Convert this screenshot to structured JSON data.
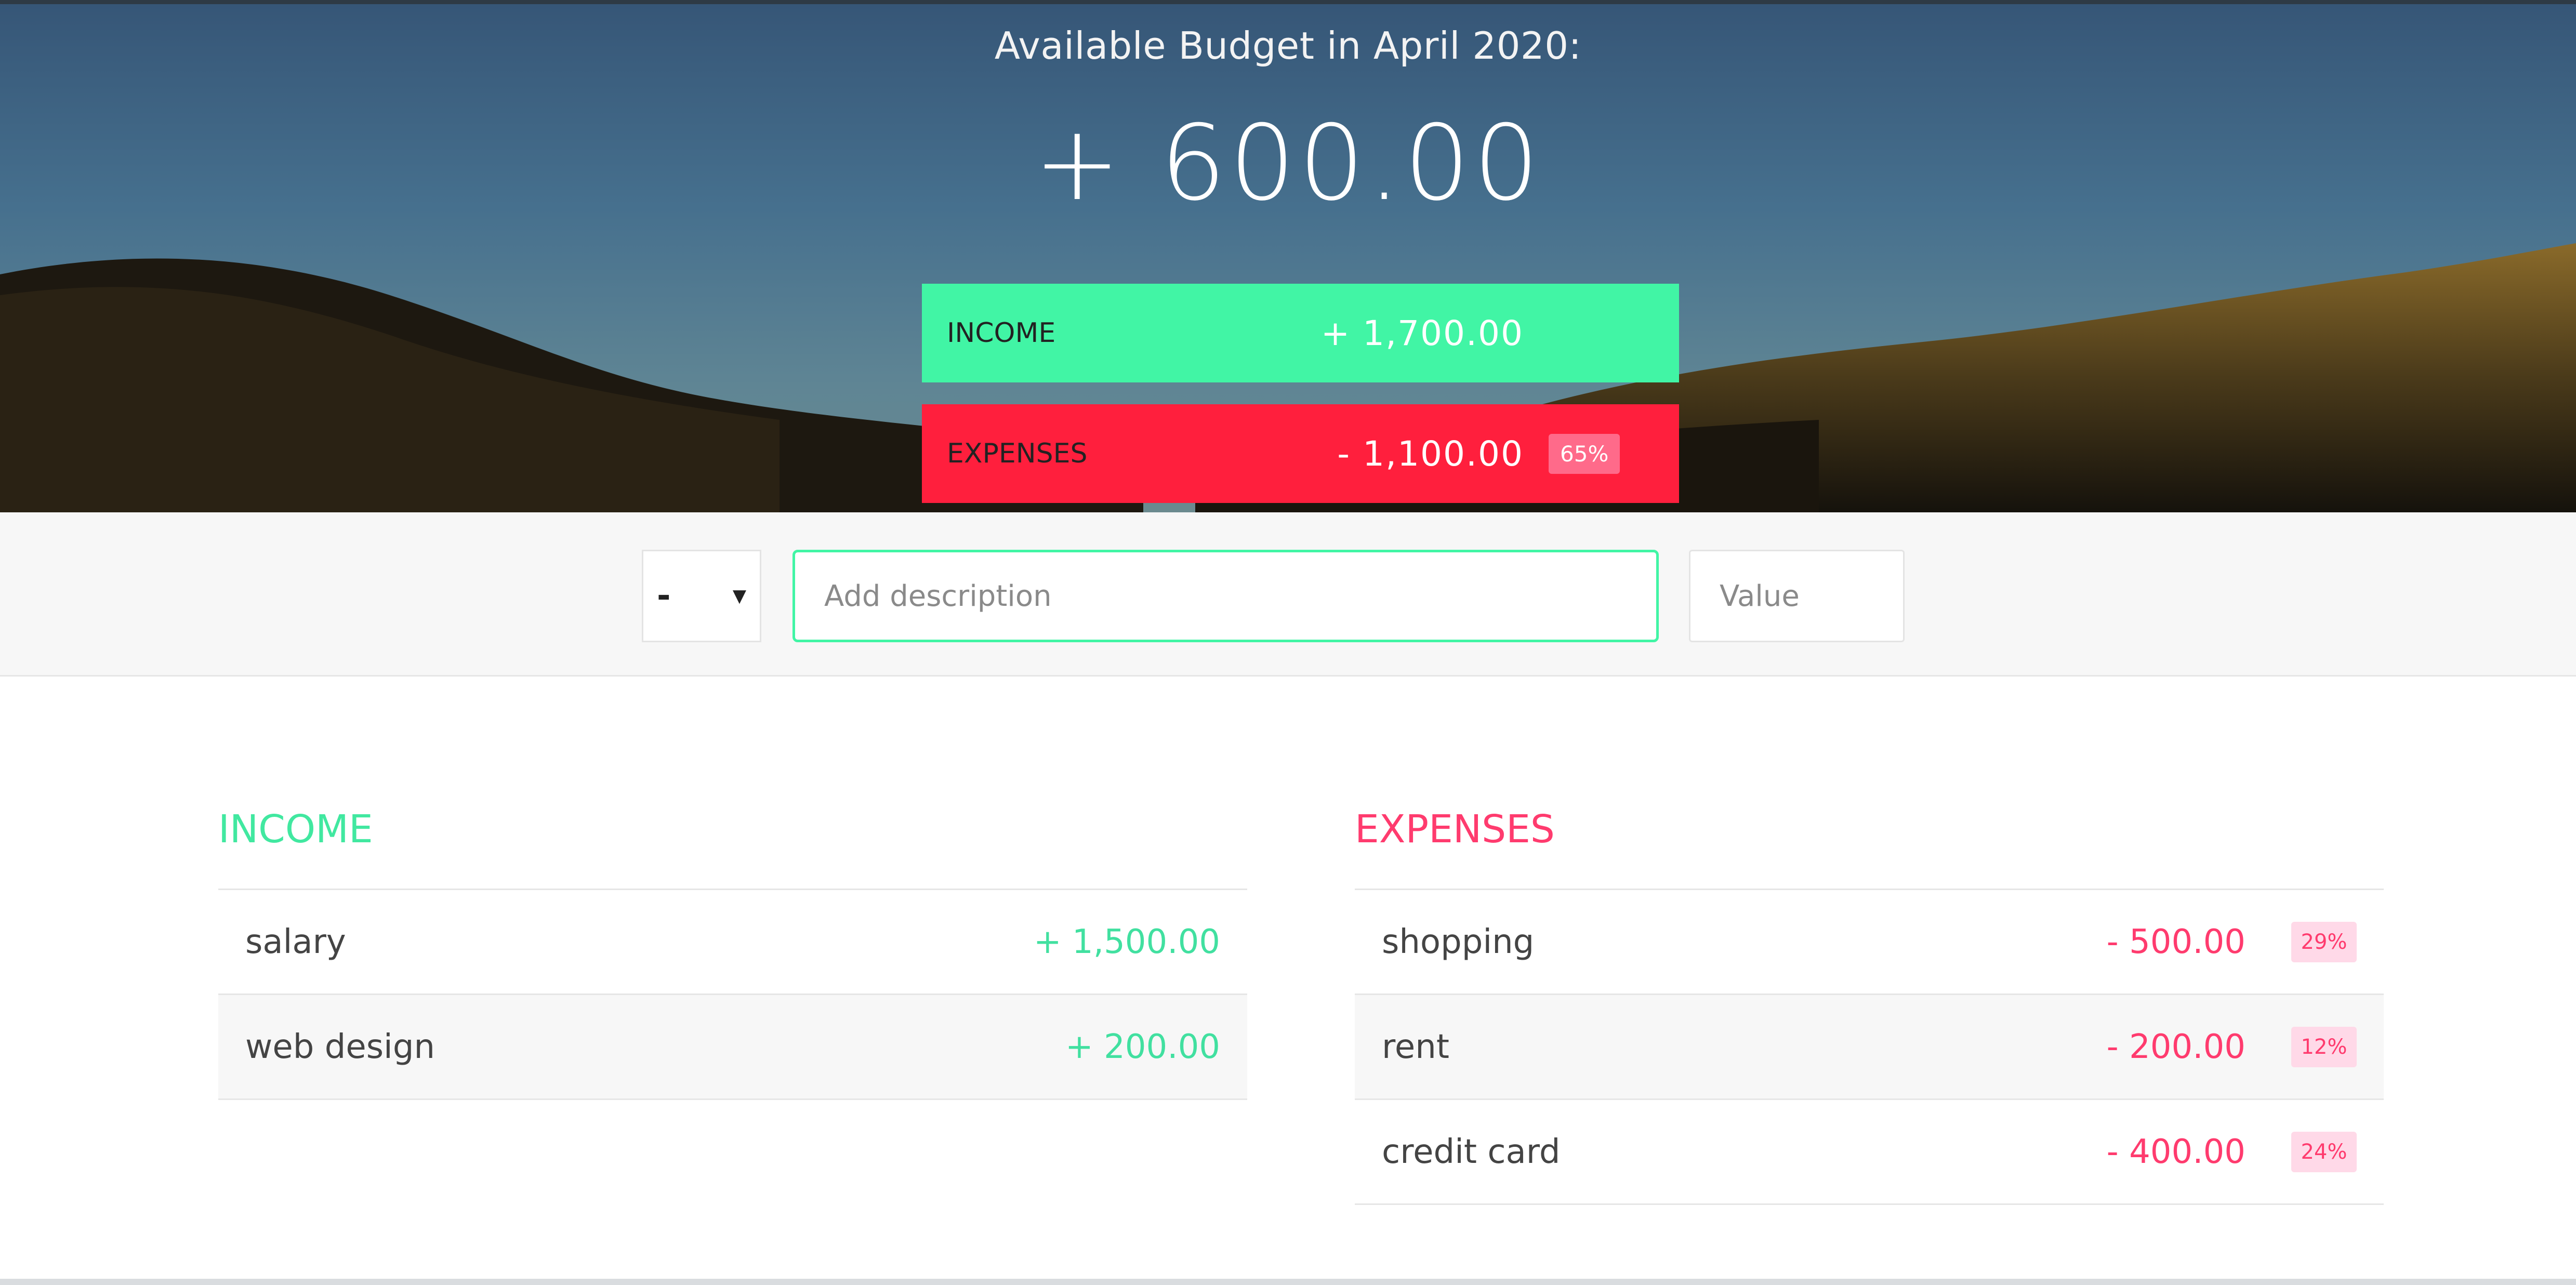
{
  "header": {
    "title": "Available Budget in April 2020:",
    "budget": "+ 600.00",
    "income": {
      "label": "INCOME",
      "value": "+ 1,700.00"
    },
    "expenses": {
      "label": "EXPENSES",
      "value": "- 1,100.00",
      "percentage": "65%"
    }
  },
  "add_bar": {
    "type_select": {
      "selected": "-",
      "options": [
        "+",
        "-"
      ]
    },
    "description_placeholder": "Add description",
    "value_placeholder": "Value"
  },
  "income_list": {
    "title": "INCOME",
    "items": [
      {
        "description": "salary",
        "value": "+ 1,500.00"
      },
      {
        "description": "web design",
        "value": "+ 200.00"
      }
    ]
  },
  "expense_list": {
    "title": "EXPENSES",
    "items": [
      {
        "description": "shopping",
        "value": "- 500.00",
        "percentage": "29%"
      },
      {
        "description": "rent",
        "value": "- 200.00",
        "percentage": "12%"
      },
      {
        "description": "credit card",
        "value": "- 400.00",
        "percentage": "24%"
      }
    ]
  },
  "colors": {
    "income_accent": "#41f5a5",
    "expense_accent": "#ff1f3d",
    "expense_text": "#ff3b6e"
  },
  "icons": {
    "select_arrow": "chevron-down-icon"
  }
}
